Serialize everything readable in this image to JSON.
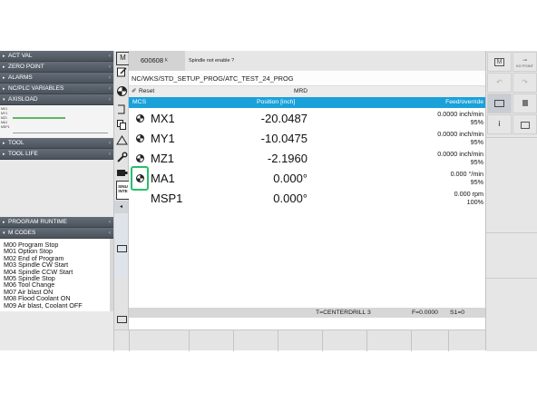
{
  "left_panel": {
    "sections_top": [
      {
        "label": "ACT VAL"
      },
      {
        "label": "ZERO POINT"
      },
      {
        "label": "ALARMS"
      },
      {
        "label": "NC/PLC VARIABLES"
      },
      {
        "label": "AXISLOAD"
      }
    ],
    "axisload_rows": [
      "MX1",
      "MY1",
      "MZ1",
      "MA1",
      "MSP1"
    ],
    "axisload_levels": [
      0,
      0,
      0.55,
      0,
      0
    ],
    "sections_mid": [
      {
        "label": "TOOL"
      },
      {
        "label": "TOOL LIFE"
      }
    ],
    "sections_bottom": [
      {
        "label": "PROGRAM RUNTIME"
      },
      {
        "label": "M CODES"
      }
    ],
    "m_codes": [
      "M00  Program Stop",
      "M01  Option Stop",
      "M02  End of Program",
      "M03  Spindle CW Start",
      "M04  Spindle CCW Start",
      "M05  Spindle Stop",
      "M06  Tool Change",
      "M07  Air blast ON",
      "M08  Flood Coolant ON",
      "M09  Air blast, Coolant OFF"
    ]
  },
  "icon_bar": {
    "icons": [
      "m-machine-icon",
      "edit-icon",
      "run-icon",
      "tool-icon",
      "copy-icon",
      "triangle-icon",
      "wrench-icon",
      "camera-icon",
      "sinumerik-icon"
    ],
    "sinumerik_label_1": "SINU",
    "sinumerik_label_2": "INTE"
  },
  "header": {
    "program_id": "600608",
    "program_id_flag": "ᵏ",
    "message": "Spindle not enable ?",
    "path": "NC/WKS/STD_SETUP_PROG/ATC_TEST_24_PROG",
    "status_reset": "Reset",
    "status_mode": "MRD"
  },
  "table": {
    "col_mcs": "MCS",
    "col_position": "Position [inch]",
    "col_feed": "Feed/override",
    "rows": [
      {
        "axis": "MX1",
        "position": "-20.0487",
        "feed": "0.0000 inch/min",
        "override": "95%"
      },
      {
        "axis": "MY1",
        "position": "-10.0475",
        "feed": "0.0000 inch/min",
        "override": "95%"
      },
      {
        "axis": "MZ1",
        "position": "-2.1960",
        "feed": "0.0000 inch/min",
        "override": "95%"
      },
      {
        "axis": "MA1",
        "position": "0.000°",
        "feed": "0.000 °/min",
        "override": "95%"
      },
      {
        "axis": "MSP1",
        "position": "0.000°",
        "feed": "0.000 rpm",
        "override": "100%"
      }
    ]
  },
  "bottom_status": {
    "tool": "T=CENTERDRILL 3",
    "feed": "F=0.0000",
    "spindle": "S1=0"
  },
  "right_panel": {
    "m_label": "M",
    "ko_point_label": "KO POINT",
    "i_label": "i"
  }
}
